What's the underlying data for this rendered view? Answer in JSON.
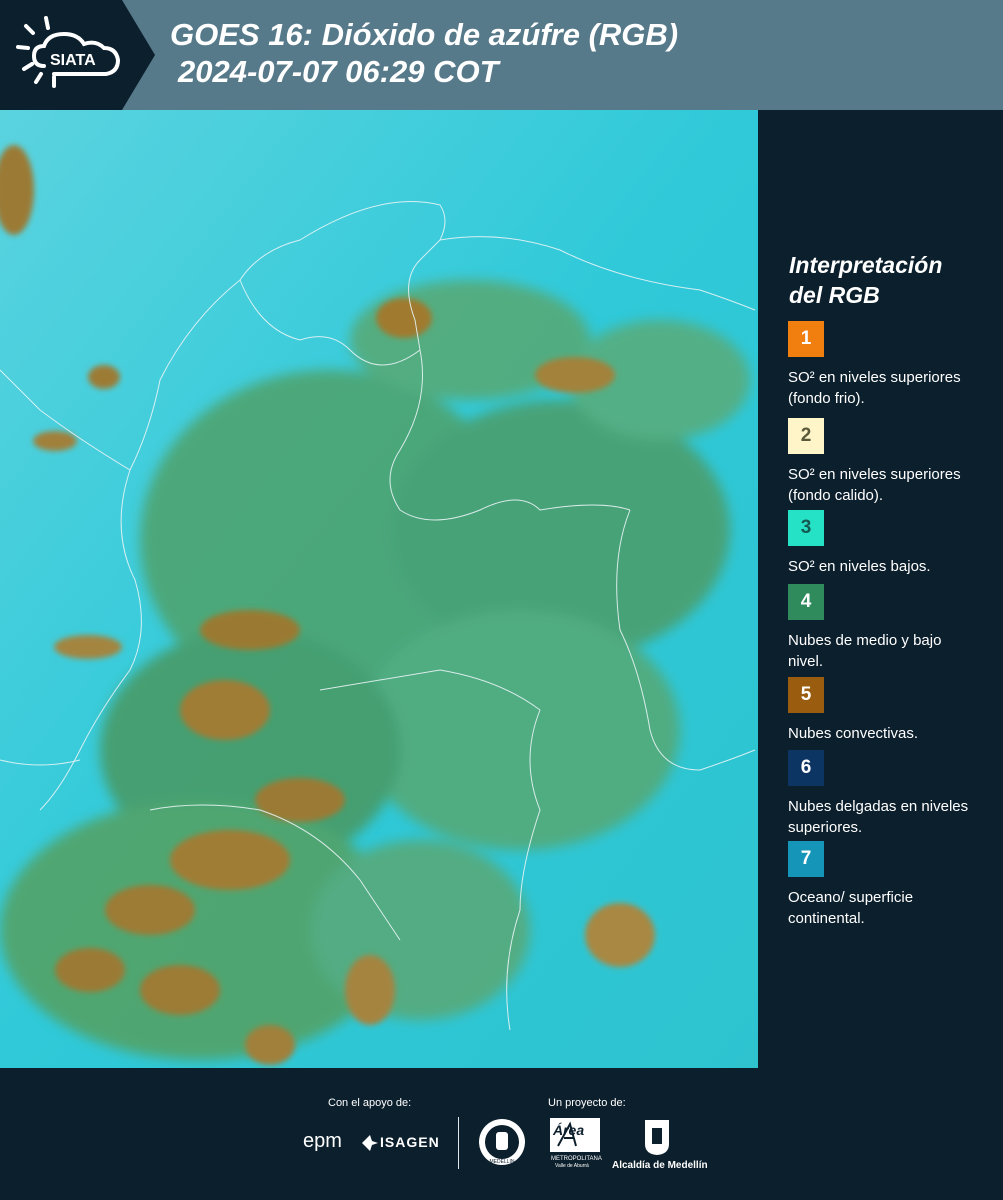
{
  "header": {
    "logo_text": "SIATA",
    "title_line1": "GOES 16: Dióxido de azúfre (RGB)",
    "title_line2": "2024-07-07 06:29 COT"
  },
  "legend": {
    "title_line1": "Interpretación",
    "title_line2": "del RGB",
    "items": [
      {
        "number": "1",
        "color": "#f07f10",
        "text": "SO² en niveles superiores (fondo frio)."
      },
      {
        "number": "2",
        "color": "#fff5c9",
        "text": "SO² en niveles superiores (fondo calido)."
      },
      {
        "number": "3",
        "color": "#25e2c6",
        "text": "SO² en niveles bajos."
      },
      {
        "number": "4",
        "color": "#2f8a5c",
        "text": "Nubes de medio y bajo nivel."
      },
      {
        "number": "5",
        "color": "#9a5d0f",
        "text": "Nubes convectivas."
      },
      {
        "number": "6",
        "color": "#0c3564",
        "text": "Nubes delgadas en niveles superiores."
      },
      {
        "number": "7",
        "color": "#1596b8",
        "text": "Oceano/ superficie continental."
      }
    ]
  },
  "footer": {
    "support_label": "Con el apoyo de:",
    "project_label": "Un proyecto de:",
    "epm": "epm",
    "isagen": "ISAGEN",
    "area_name": "Área",
    "area_sub": "METROPOLITANA",
    "area_sub2": "Valle de Aburrá",
    "alcaldia": "Alcaldía de Medellín",
    "seal_text": "MEDELLIN"
  },
  "colors": {
    "header_bg": "#567a8a",
    "panel_bg": "#0c1f2c",
    "ocean": "#2fc9d9",
    "cloud_green": "#4e9a5a",
    "convective": "#a07a2e"
  }
}
